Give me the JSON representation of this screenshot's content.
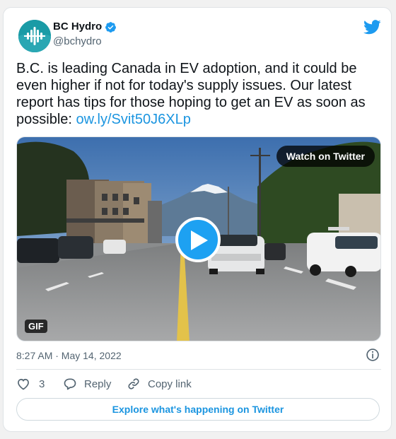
{
  "tweet": {
    "author_name": "BC Hydro",
    "handle": "@bchydro",
    "text": "B.C. is leading Canada in EV adoption, and it could be even higher if not for today's supply issues. Our latest report has tips for those hoping to get an EV as soon as possible: ",
    "link_text": "ow.ly/Svit50J6XLp",
    "timestamp": "8:27 AM · May 14, 2022"
  },
  "media": {
    "watch_label": "Watch on Twitter",
    "gif_label": "GIF"
  },
  "actions": {
    "like_count": "3",
    "reply_label": "Reply",
    "copy_link_label": "Copy link"
  },
  "footer": {
    "explore_label": "Explore what's happening on Twitter"
  },
  "colors": {
    "accent": "#1b95e0",
    "play_button": "#1da1f2",
    "avatar_bg": "#1a9ba6"
  },
  "icons": {
    "avatar": "bc-hydro-logo",
    "verified": "verified-badge-icon",
    "brand": "twitter-bird-icon",
    "info": "info-icon",
    "like": "heart-icon",
    "reply": "reply-bubble-icon",
    "copy": "link-icon",
    "play": "play-icon"
  }
}
